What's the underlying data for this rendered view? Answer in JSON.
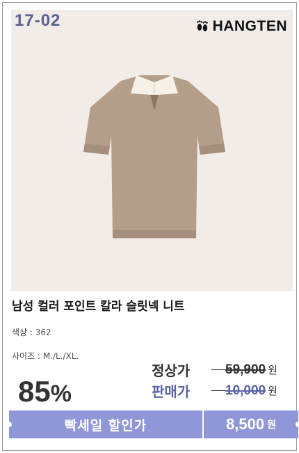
{
  "image": {
    "code": "17-02",
    "brand": "HANGTEN",
    "brand_icon": "footprints-icon",
    "background": "#f1ece8",
    "product_color": "#b49e8a",
    "collar_color": "#f6f1e6"
  },
  "product": {
    "name": "남성 컬러 포인트 칼라 슬릿넥 니트",
    "color_label": "색상 :",
    "color_value": "362",
    "size_label": "사이즈 :",
    "size_value": "M./L./XL."
  },
  "pricing": {
    "discount": "85",
    "discount_symbol": "%",
    "regular_label": "정상가",
    "regular_price": "59,900",
    "sale_label": "판매가",
    "sale_price": "10,000",
    "currency": "원"
  },
  "cta": {
    "flash_label": "빡세일 할인가",
    "final_price": "8,500",
    "currency": "원",
    "accent": "#8f97d8"
  }
}
